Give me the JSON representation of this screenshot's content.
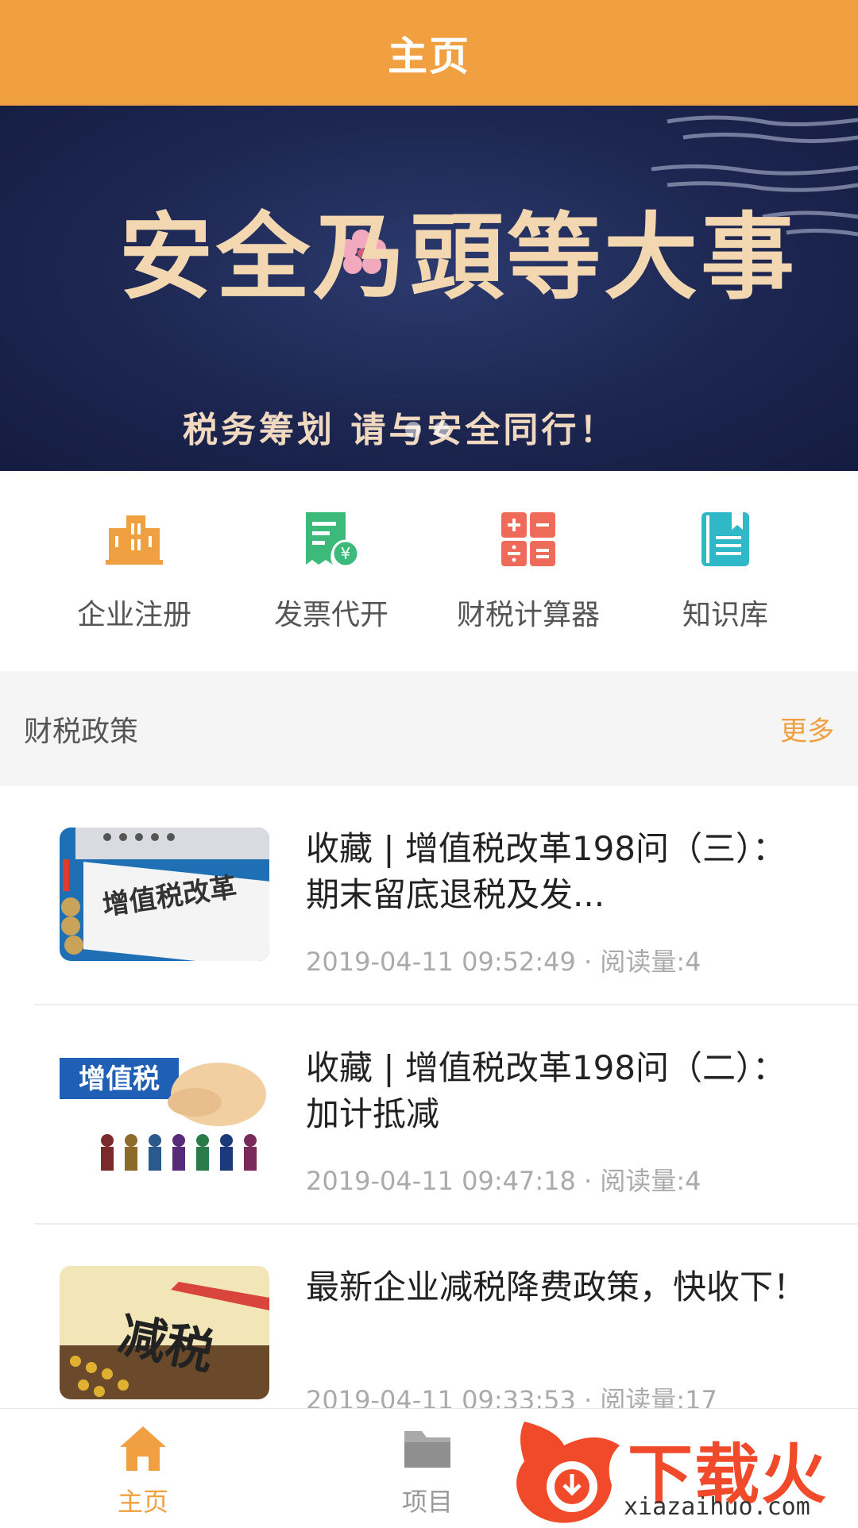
{
  "header": {
    "title": "主页"
  },
  "banner": {
    "headline": "安全乃頭等大事",
    "subline": "税务筹划 请与安全同行！",
    "dots": 2
  },
  "shortcuts": [
    {
      "label": "企业注册",
      "icon": "building-icon",
      "color": "#F0A040"
    },
    {
      "label": "发票代开",
      "icon": "invoice-icon",
      "color": "#3DBA7A"
    },
    {
      "label": "财税计算器",
      "icon": "calculator-icon",
      "color": "#EE6B5A"
    },
    {
      "label": "知识库",
      "icon": "book-icon",
      "color": "#2FB8C8"
    }
  ],
  "section": {
    "title": "财税政策",
    "more": "更多"
  },
  "news": [
    {
      "title": "收藏 | 增值税改革198问（三）：期末留底退税及发...",
      "meta": "2019-04-11 09:52:49 · 阅读量:4",
      "thumb_text": "增值税改革"
    },
    {
      "title": "收藏 | 增值税改革198问（二）：加计抵减",
      "meta": "2019-04-11 09:47:18 · 阅读量:4",
      "thumb_text": "增值税"
    },
    {
      "title": "最新企业减税降费政策，快收下！",
      "meta": "2019-04-11 09:33:53 · 阅读量:17",
      "thumb_text": "减税"
    }
  ],
  "bottom_nav": [
    {
      "label": "主页",
      "icon": "home-icon",
      "active": true
    },
    {
      "label": "项目",
      "icon": "folder-icon",
      "active": false
    }
  ],
  "watermark": {
    "text": "下载火",
    "sub": "xiazaihuo.com"
  },
  "colors": {
    "accent": "#F0A040",
    "banner_bg": "#1c2650"
  }
}
